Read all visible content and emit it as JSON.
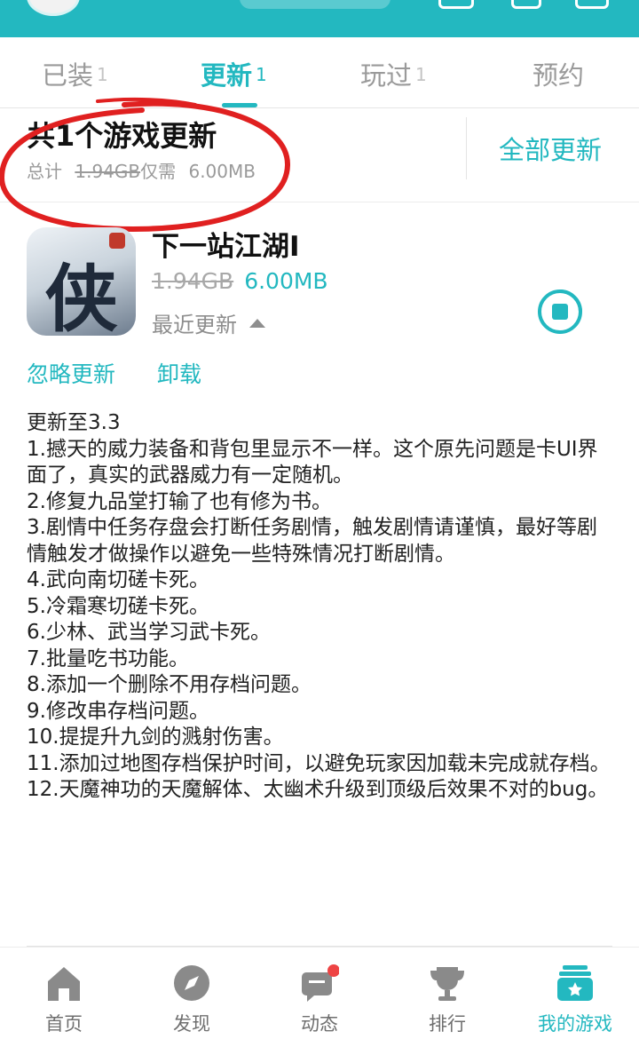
{
  "colors": {
    "accent": "#23b8c0",
    "annotation": "#e02020",
    "badge": "#ee4444"
  },
  "tabs": [
    {
      "label": "已装",
      "count": "1"
    },
    {
      "label": "更新",
      "count": "1"
    },
    {
      "label": "玩过",
      "count": "1"
    },
    {
      "label": "预约",
      "count": ""
    }
  ],
  "summary": {
    "title": "共1个游戏更新",
    "total_label": "总计",
    "old_size": "1.94GB",
    "needs_label": "仅需",
    "new_size": "6.00MB",
    "update_all": "全部更新"
  },
  "game": {
    "icon_glyph": "侠",
    "name": "下一站江湖Ⅰ",
    "old_size": "1.94GB",
    "new_size": "6.00MB",
    "recent_label": "最近更新",
    "ignore_label": "忽略更新",
    "uninstall_label": "卸载"
  },
  "notes": {
    "heading": "更新至3.3",
    "items": [
      "1.撼天的威力装备和背包里显示不一样。这个原先问题是卡UI界面了，真实的武器威力有一定随机。",
      "2.修复九品堂打输了也有修为书。",
      "3.剧情中任务存盘会打断任务剧情，触发剧情请谨慎，最好等剧情触发才做操作以避免一些特殊情况打断剧情。",
      "4.武向南切磋卡死。",
      "5.冷霜寒切磋卡死。",
      "6.少林、武当学习武卡死。",
      "7.批量吃书功能。",
      "8.添加一个删除不用存档问题。",
      "9.修改串存档问题。",
      "10.提提升九剑的溅射伤害。",
      "11.添加过地图存档保护时间，以避免玩家因加载未完成就存档。",
      "12.天魔神功的天魔解体、太幽术升级到顶级后效果不对的bug。"
    ]
  },
  "bottom_nav": [
    {
      "label": "首页",
      "icon": "home-icon"
    },
    {
      "label": "发现",
      "icon": "compass-icon"
    },
    {
      "label": "动态",
      "icon": "chat-camera-icon"
    },
    {
      "label": "排行",
      "icon": "trophy-icon"
    },
    {
      "label": "我的游戏",
      "icon": "my-games-icon"
    }
  ]
}
